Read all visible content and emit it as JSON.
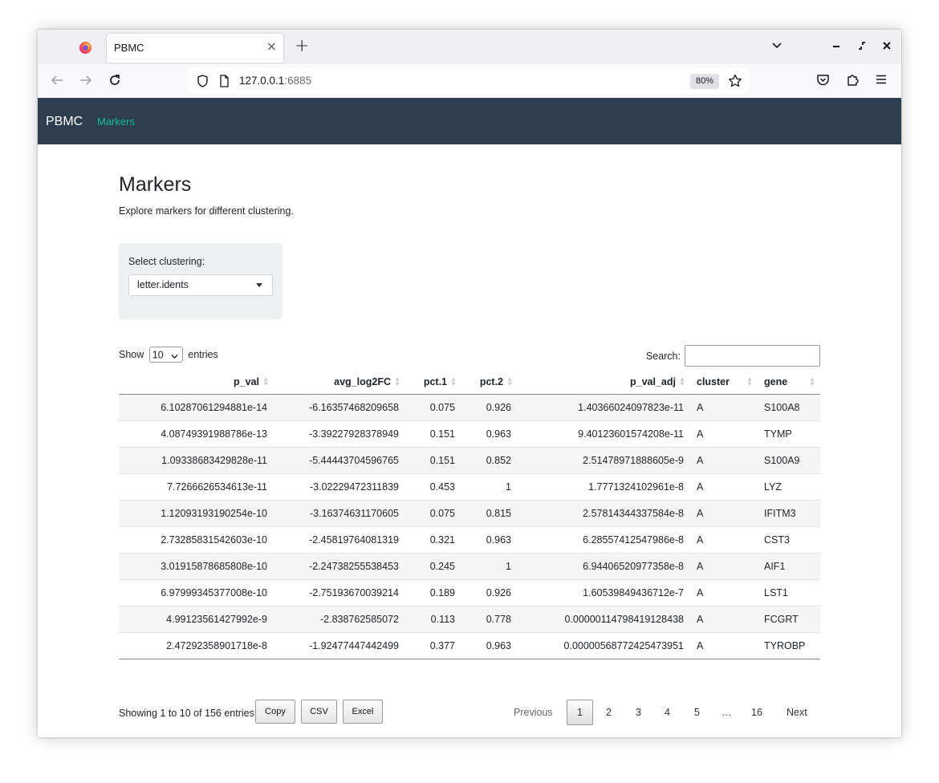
{
  "browser": {
    "tab_title": "PBMC",
    "tab_close": "×",
    "new_tab": "+",
    "url_host": "127.0.0.1",
    "url_port": ":6885",
    "zoom": "80%"
  },
  "app": {
    "brand": "PBMC",
    "nav_link": "Markers"
  },
  "page": {
    "title": "Markers",
    "subtitle": "Explore markers for different clustering."
  },
  "controls": {
    "clustering_label": "Select clustering:",
    "clustering_value": "letter.idents",
    "show_label": "Show",
    "entries_value": "10",
    "entries_label": "entries",
    "search_label": "Search:",
    "search_value": ""
  },
  "table": {
    "columns": [
      "p_val",
      "avg_log2FC",
      "pct.1",
      "pct.2",
      "p_val_adj",
      "cluster",
      "gene"
    ],
    "rows": [
      [
        "6.10287061294881e-14",
        "-6.16357468209658",
        "0.075",
        "0.926",
        "1.40366024097823e-11",
        "A",
        "S100A8"
      ],
      [
        "4.08749391988786e-13",
        "-3.39227928378949",
        "0.151",
        "0.963",
        "9.40123601574208e-11",
        "A",
        "TYMP"
      ],
      [
        "1.09338683429828e-11",
        "-5.44443704596765",
        "0.151",
        "0.852",
        "2.51478971888605e-9",
        "A",
        "S100A9"
      ],
      [
        "7.7266626534613e-11",
        "-3.02229472311839",
        "0.453",
        "1",
        "1.7771324102961e-8",
        "A",
        "LYZ"
      ],
      [
        "1.12093193190254e-10",
        "-3.16374631170605",
        "0.075",
        "0.815",
        "2.57814344337584e-8",
        "A",
        "IFITM3"
      ],
      [
        "2.73285831542603e-10",
        "-2.45819764081319",
        "0.321",
        "0.963",
        "6.28557412547986e-8",
        "A",
        "CST3"
      ],
      [
        "3.01915878685808e-10",
        "-2.24738255538453",
        "0.245",
        "1",
        "6.94406520977358e-8",
        "A",
        "AIF1"
      ],
      [
        "6.97999345377008e-10",
        "-2.75193670039214",
        "0.189",
        "0.926",
        "1.60539849436712e-7",
        "A",
        "LST1"
      ],
      [
        "4.99123561427992e-9",
        "-2.838762585072",
        "0.113",
        "0.778",
        "0.00000114798419128438",
        "A",
        "FCGRT"
      ],
      [
        "2.47292358901718e-8",
        "-1.92477447442499",
        "0.377",
        "0.963",
        "0.00000568772425473951",
        "A",
        "TYROBP"
      ]
    ]
  },
  "footer": {
    "info": "Showing 1 to 10 of 156 entries",
    "buttons": [
      "Copy",
      "CSV",
      "Excel"
    ],
    "pagination": {
      "previous": "Previous",
      "pages": [
        "1",
        "2",
        "3",
        "4",
        "5",
        "…",
        "16"
      ],
      "current": "1",
      "next": "Next"
    }
  }
}
